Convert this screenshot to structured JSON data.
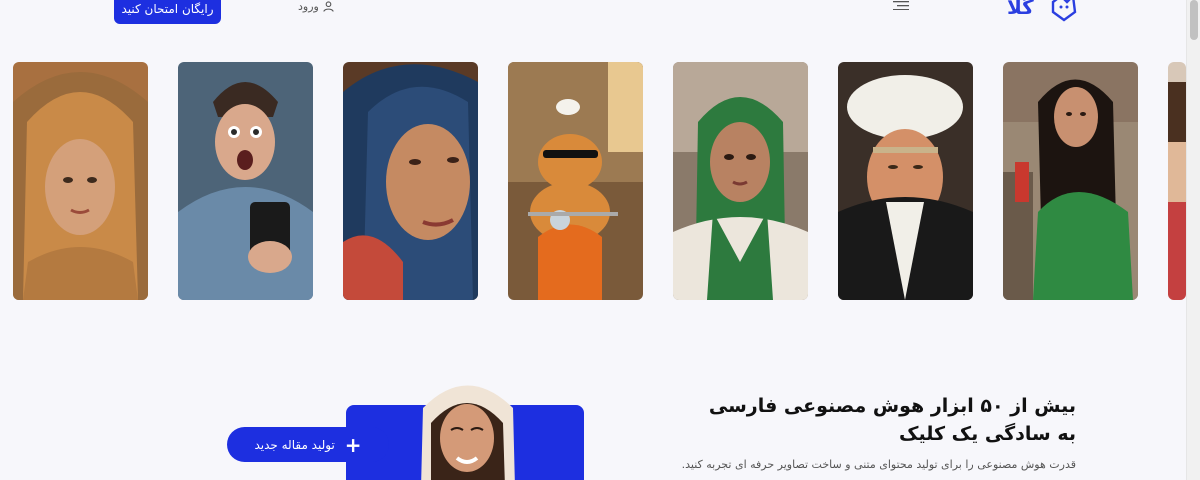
{
  "header": {
    "try_label": "رایگان امتحان کنید",
    "login_label": "ورود",
    "logo_text": "گلا"
  },
  "gallery": [
    {
      "name": "woman-patterned-scarf"
    },
    {
      "name": "shocked-man-phone"
    },
    {
      "name": "woman-navy-scarf"
    },
    {
      "name": "cat-scooter-duck"
    },
    {
      "name": "woman-green-scarf"
    },
    {
      "name": "man-white-turban"
    },
    {
      "name": "woman-green-shawl"
    },
    {
      "name": "boy-partial"
    }
  ],
  "hero": {
    "title": "بیش از ۵۰ ابزار هوش مصنوعی فارسی به سادگی یک کلیک",
    "subtitle": "قدرت هوش مصنوعی را برای تولید محتوای متنی و ساخت تصاویر حرفه ای تجربه کنید.",
    "article_button": "تولید مقاله جدید",
    "plus_icon": "+"
  },
  "colors": {
    "accent": "#1d2fe0",
    "background": "#f7f7fb"
  }
}
